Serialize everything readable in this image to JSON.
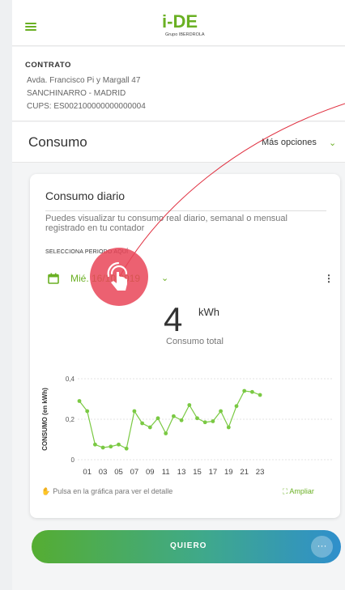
{
  "header": {
    "menu_icon": "hamburger-icon",
    "logo_text": "i-DE",
    "logo_sub": "Grupo IBERDROLA"
  },
  "contract": {
    "title": "CONTRATO",
    "address": "Avda. Francisco Pi y Margall 47",
    "city": "SANCHINARRO - MADRID",
    "cups": "CUPS: ES002100000000000004"
  },
  "consumo": {
    "title": "Consumo",
    "options": "Más opciones"
  },
  "card": {
    "title": "Consumo diario",
    "description": "Puedes visualizar tu consumo real diario, semanal o mensual registrado en tu contador",
    "period_label": "SELECCIONA PERIODO AQUÍ",
    "date": "Mié. 16/10/2019",
    "total_value": "4",
    "total_unit": "kWh",
    "total_label": "Consumo total",
    "hint": "Pulsa en la gráfica para ver el detalle",
    "zoom": "Ampliar"
  },
  "chart_data": {
    "type": "line",
    "ylabel": "CONSUMO (en kWh)",
    "xlabel": "",
    "ylim": [
      0,
      0.4
    ],
    "y_ticks": [
      "0",
      "0,2",
      "0,4"
    ],
    "x_ticks": [
      "01",
      "03",
      "05",
      "07",
      "09",
      "11",
      "13",
      "15",
      "17",
      "19",
      "21",
      "23"
    ],
    "x": [
      0,
      1,
      2,
      3,
      4,
      5,
      6,
      7,
      8,
      9,
      10,
      11,
      12,
      13,
      14,
      15,
      16,
      17,
      18,
      19,
      20,
      21,
      22,
      23
    ],
    "values": [
      0.29,
      0.24,
      0.075,
      0.06,
      0.065,
      0.075,
      0.055,
      0.24,
      0.18,
      0.16,
      0.205,
      0.13,
      0.215,
      0.195,
      0.27,
      0.205,
      0.185,
      0.19,
      0.24,
      0.16,
      0.265,
      0.34,
      0.335,
      0.32
    ],
    "color": "#7ac943",
    "grid": true
  },
  "cta": {
    "label": "QUIERO",
    "more_icon": "more-dots-icon"
  },
  "colors": {
    "brand_green": "#6ab023",
    "tap_indicator": "#e94558"
  }
}
